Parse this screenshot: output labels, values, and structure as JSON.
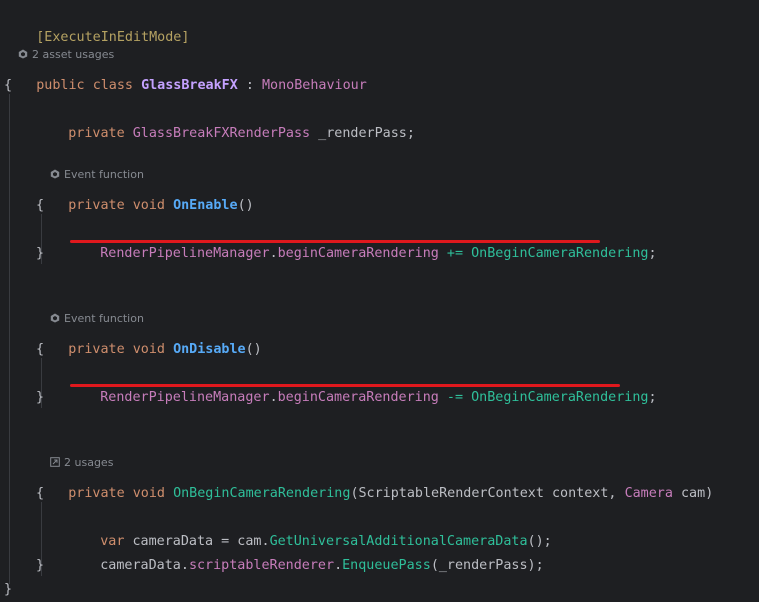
{
  "colors": {
    "background": "#1e1f22",
    "keyword": "#cf8e6d",
    "type": "#c77dbb",
    "method": "#57aaf7",
    "event_handler": "#3fc1a0",
    "underline": "#e0181d",
    "hint": "#868a91"
  },
  "hints": {
    "asset_usages": "2 asset usages",
    "event_function_1": "Event function",
    "event_function_2": "Event function",
    "usages": "2 usages"
  },
  "icons": {
    "asset_usages": "unity-icon",
    "event_function_1": "unity-icon",
    "event_function_2": "unity-icon",
    "usages": "usages-link-icon"
  },
  "code": {
    "l1": {
      "attr": "[ExecuteInEditMode]"
    },
    "l2": {
      "kw1": "public",
      "kw2": "class",
      "name": "GlassBreakFX",
      "colon": " : ",
      "base": "MonoBehaviour"
    },
    "l3": {
      "text": "{"
    },
    "l4": {
      "kw": "private",
      "type": "GlassBreakFXRenderPass",
      "field": " _renderPass",
      "end": ";"
    },
    "l5": {
      "kw1": "private",
      "kw2": "void",
      "name": "OnEnable",
      "parens": "()"
    },
    "l6": {
      "text": "{"
    },
    "l7": {
      "mgr": "RenderPipelineManager",
      "dot": ".",
      "evt": "beginCameraRendering",
      "op": " += ",
      "handler": "OnBeginCameraRendering",
      "end": ";"
    },
    "l8": {
      "text": "}"
    },
    "l9": {
      "kw1": "private",
      "kw2": "void",
      "name": "OnDisable",
      "parens": "()"
    },
    "l10": {
      "text": "{"
    },
    "l11": {
      "mgr": "RenderPipelineManager",
      "dot": ".",
      "evt": "beginCameraRendering",
      "op": " -= ",
      "handler": "OnBeginCameraRendering",
      "end": ";"
    },
    "l12": {
      "text": "}"
    },
    "l13": {
      "kw1": "private",
      "kw2": "void",
      "name": "OnBeginCameraRendering",
      "open": "(",
      "ptype1": "ScriptableRenderContext",
      "p1": " context, ",
      "ptype2": "Camera",
      "p2": " cam",
      "close": ")"
    },
    "l14": {
      "text": "{"
    },
    "l15": {
      "kw": "var",
      "rest1": " cameraData = cam.",
      "method": "GetUniversalAdditionalCameraData",
      "rest2": "();"
    },
    "l16": {
      "obj": "cameraData.",
      "prop": "scriptableRenderer",
      "dot": ".",
      "method": "EnqueuePass",
      "args": "(_renderPass);"
    },
    "l17": {
      "text": "}"
    },
    "l18": {
      "text": "}"
    }
  }
}
